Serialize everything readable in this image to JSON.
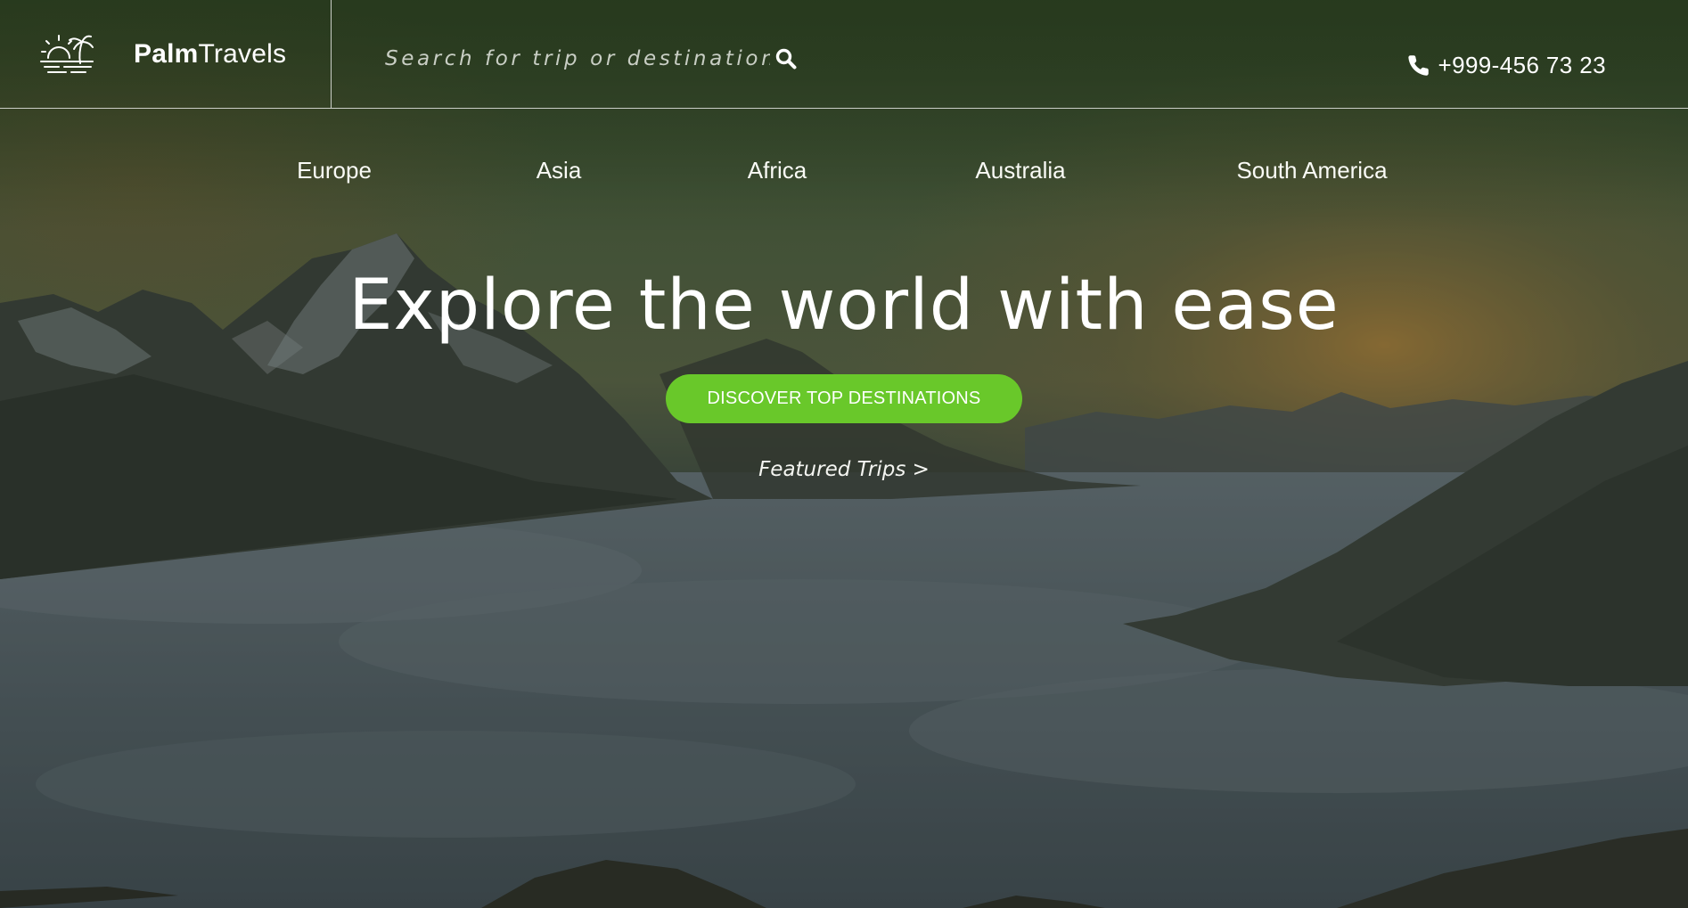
{
  "brand": {
    "name_bold": "Palm",
    "name_light": "Travels",
    "logo_icon": "palm-sunset-logo-icon"
  },
  "search": {
    "placeholder": "Search for trip or destination",
    "value": "",
    "icon": "search-icon"
  },
  "contact": {
    "phone": "+999-456 73 23",
    "icon": "phone-icon"
  },
  "nav": {
    "items": [
      {
        "label": "Europe"
      },
      {
        "label": "Asia"
      },
      {
        "label": "Africa"
      },
      {
        "label": "Australia"
      },
      {
        "label": "South America"
      }
    ]
  },
  "hero": {
    "title": "Explore the world with ease",
    "cta_label": "DISCOVER TOP DESTINATIONS",
    "secondary_link": "Featured Trips >"
  },
  "colors": {
    "accent": "#69c82a",
    "overlay_green": "#2e4023",
    "header_divider": "#ffffff"
  }
}
